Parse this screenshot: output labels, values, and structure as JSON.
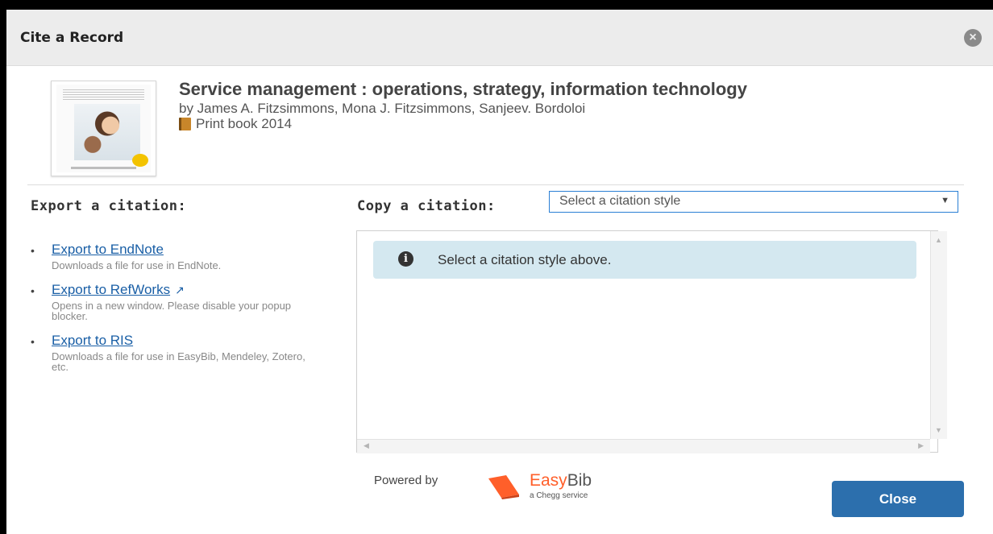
{
  "dialog": {
    "title": "Cite a Record",
    "close_icon_glyph": "×"
  },
  "record": {
    "title": "Service management : operations, strategy, information technology",
    "author": "by James A. Fitzsimmons, Mona J. Fitzsimmons, Sanjeev. Bordoloi",
    "format": "Print book 2014",
    "format_icon": "book-icon"
  },
  "export": {
    "heading": "Export a citation:",
    "items": [
      {
        "label": "Export to EndNote",
        "description": "Downloads a file for use in EndNote."
      },
      {
        "label": "Export to RefWorks",
        "description": "Opens in a new window. Please disable your popup blocker.",
        "icon": "external-link-icon"
      },
      {
        "label": "Export to RIS",
        "description": "Downloads a file for use in EasyBib, Mendeley, Zotero, etc."
      }
    ]
  },
  "copy": {
    "heading": "Copy a citation:",
    "select_value": "Select a citation style",
    "alert_message": "Select a citation style above."
  },
  "footer": {
    "powered_by": "Powered by",
    "brand_part1": "Easy",
    "brand_part2": "Bib",
    "brand_sub": "a Chegg service",
    "close_label": "Close"
  },
  "colors": {
    "link": "#1a5fa6",
    "accent_button": "#2c6fad",
    "alert_bg": "#d4e8f0",
    "easybib_orange": "#ff5f2a"
  }
}
